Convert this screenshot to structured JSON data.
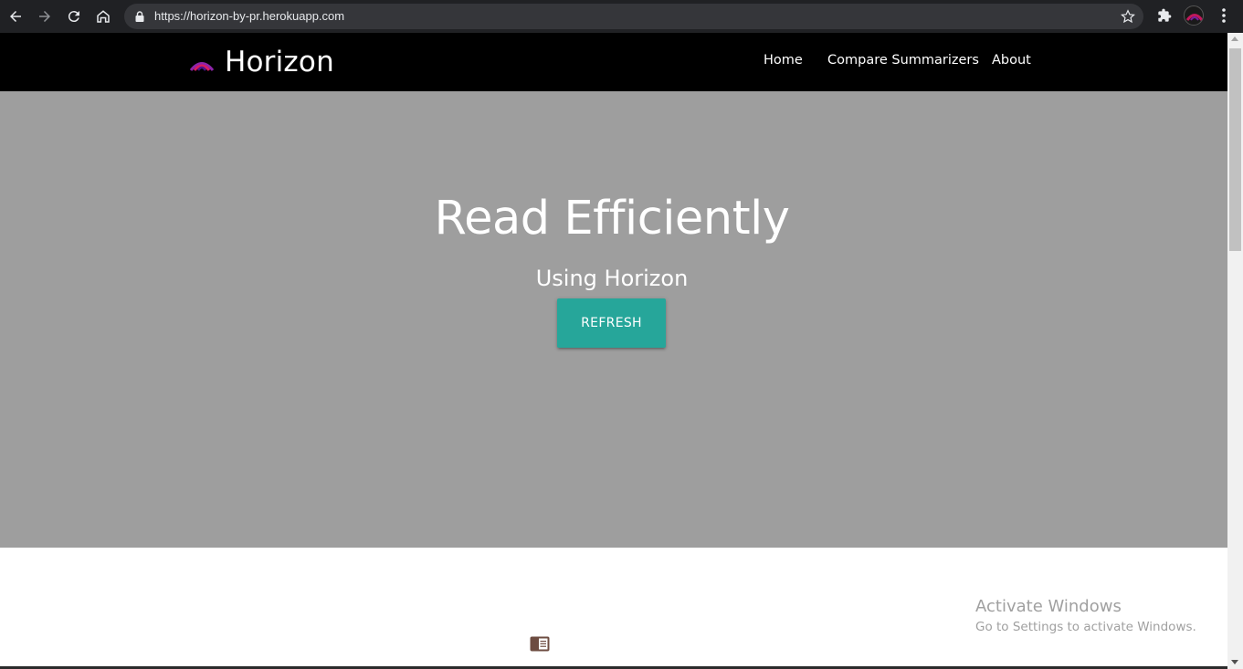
{
  "browser": {
    "url": "https://horizon-by-pr.herokuapp.com"
  },
  "site": {
    "brand": "Horizon",
    "nav": [
      "Home",
      "Compare Summarizers",
      "About"
    ]
  },
  "hero": {
    "title": "Read Efficiently",
    "subtitle": "Using Horizon",
    "button_label": "REFRESH"
  },
  "watermark": {
    "title": "Activate Windows",
    "subtitle": "Go to Settings to activate Windows."
  },
  "colors": {
    "navbar": "#000000",
    "hero_bg": "#9e9e9e",
    "accent": "#26a69a",
    "browser_chrome": "#202124"
  }
}
